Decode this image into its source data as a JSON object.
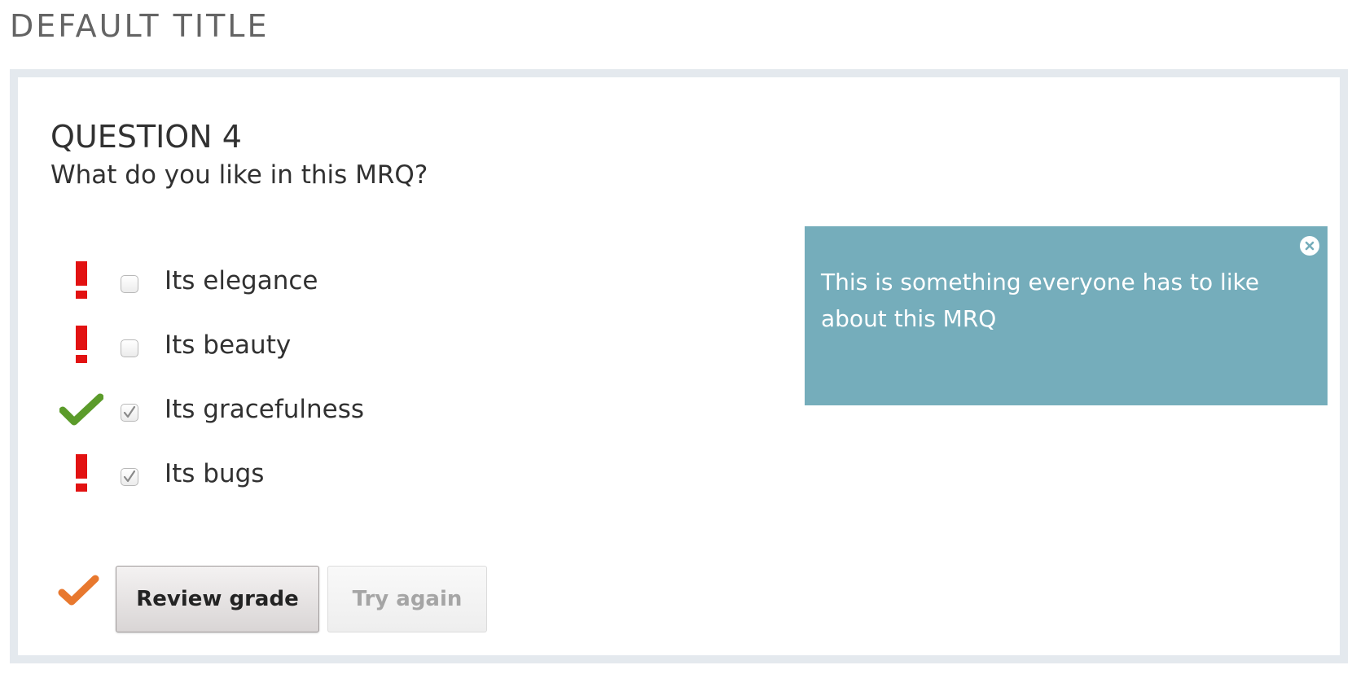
{
  "page": {
    "title": "DEFAULT TITLE"
  },
  "question": {
    "title": "QUESTION 4",
    "text": "What do you like in this MRQ?"
  },
  "choices": [
    {
      "label": "Its elegance",
      "checked": false,
      "result": "incorrect"
    },
    {
      "label": "Its beauty",
      "checked": false,
      "result": "incorrect"
    },
    {
      "label": "Its gracefulness",
      "checked": true,
      "result": "correct"
    },
    {
      "label": "Its bugs",
      "checked": true,
      "result": "incorrect"
    }
  ],
  "tip": {
    "text": "This is something everyone has to like about this MRQ",
    "close_icon": "close-icon"
  },
  "actions": {
    "status_icon": "checkmark-icon",
    "review_label": "Review grade",
    "try_label": "Try again"
  },
  "colors": {
    "frame": "#e4e9ee",
    "tip_background": "#75adbb",
    "incorrect": "#e21212",
    "correct": "#5b9b2a",
    "status": "#e8782e"
  }
}
